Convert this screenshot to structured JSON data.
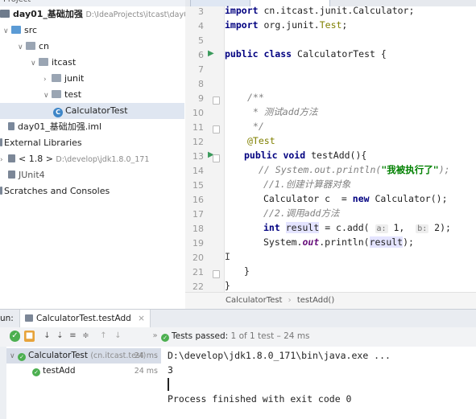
{
  "project": {
    "tree": [
      {
        "label": "day01_基础加强",
        "path": "D:\\IdeaProjects\\itcast\\day01_基础加强"
      },
      {
        "label": "src"
      },
      {
        "label": "cn"
      },
      {
        "label": "itcast"
      },
      {
        "label": "junit"
      },
      {
        "label": "test"
      },
      {
        "label": "CalculatorTest"
      },
      {
        "label": "day01_基础加强.iml"
      },
      {
        "label": "External Libraries"
      },
      {
        "label": "< 1.8 >",
        "path": "D:\\develop\\jdk1.8.0_171"
      },
      {
        "label": "JUnit4"
      },
      {
        "label": "Scratches and Consoles"
      }
    ]
  },
  "editor": {
    "line_numbers": [
      "3",
      "4",
      "5",
      "6",
      "7",
      "8",
      "9",
      "10",
      "11",
      "12",
      "13",
      "14",
      "15",
      "16",
      "17",
      "18",
      "19",
      "20",
      "21",
      "22"
    ],
    "code": {
      "l3_kw": "import",
      "l3_rest": " cn.itcast.junit.Calculator;",
      "l4_kw": "import",
      "l4_rest": " org.junit.",
      "l4_test": "Test",
      "l4_end": ";",
      "l6_kw": "public class",
      "l6_rest": " CalculatorTest {",
      "l9": "/**",
      "l10": " * 测试add方法",
      "l11": " */",
      "l12": "@Test",
      "l13_kw": "public void",
      "l13_rest": " testAdd(){",
      "l14_a": "// System.out.println(",
      "l14_str": "\"我被执行了\"",
      "l14_b": ");",
      "l15": "//1.创建计算器对象",
      "l16_a": "Calculator c  = ",
      "l16_kw": "new",
      "l16_b": " Calculator();",
      "l17": "//2.调用add方法",
      "l18_kw": "int",
      "l18_var": "result",
      "l18_a": " = c.add( ",
      "l18_hint1": "a:",
      "l18_v1": " 1,  ",
      "l18_hint2": "b:",
      "l18_v2": " 2);",
      "l19_a": "System.",
      "l19_field": "out",
      "l19_b": ".println(",
      "l19_var": "result",
      "l19_c": ");",
      "l21": "}",
      "l22": "}"
    }
  },
  "breadcrumb": [
    "CalculatorTest",
    "testAdd()"
  ],
  "run": {
    "tool_label": "un:",
    "tab_label": "CalculatorTest.testAdd",
    "status": "Tests passed:",
    "status_detail": "1 of 1 test – 24 ms",
    "tests": [
      {
        "name": "CalculatorTest",
        "detail": "(cn.itcast.test)",
        "duration": "24 ms"
      },
      {
        "name": "testAdd",
        "duration": "24 ms"
      }
    ],
    "console": [
      "D:\\develop\\jdk1.8.0_171\\bin\\java.exe ...",
      "3",
      "",
      "Process finished with exit code 0"
    ]
  },
  "icons": [
    "check-icon",
    "stop-icon",
    "sort-alpha-icon",
    "sort-duration-icon",
    "expand-all-icon",
    "collapse-all-icon",
    "prev-icon",
    "next-icon",
    "pass-icon",
    "run-gutter-icon"
  ],
  "colors": {
    "keyword": "#000080",
    "comment": "#808080",
    "string": "#008000",
    "pass": "#4caf50",
    "annotation": "#808000"
  }
}
